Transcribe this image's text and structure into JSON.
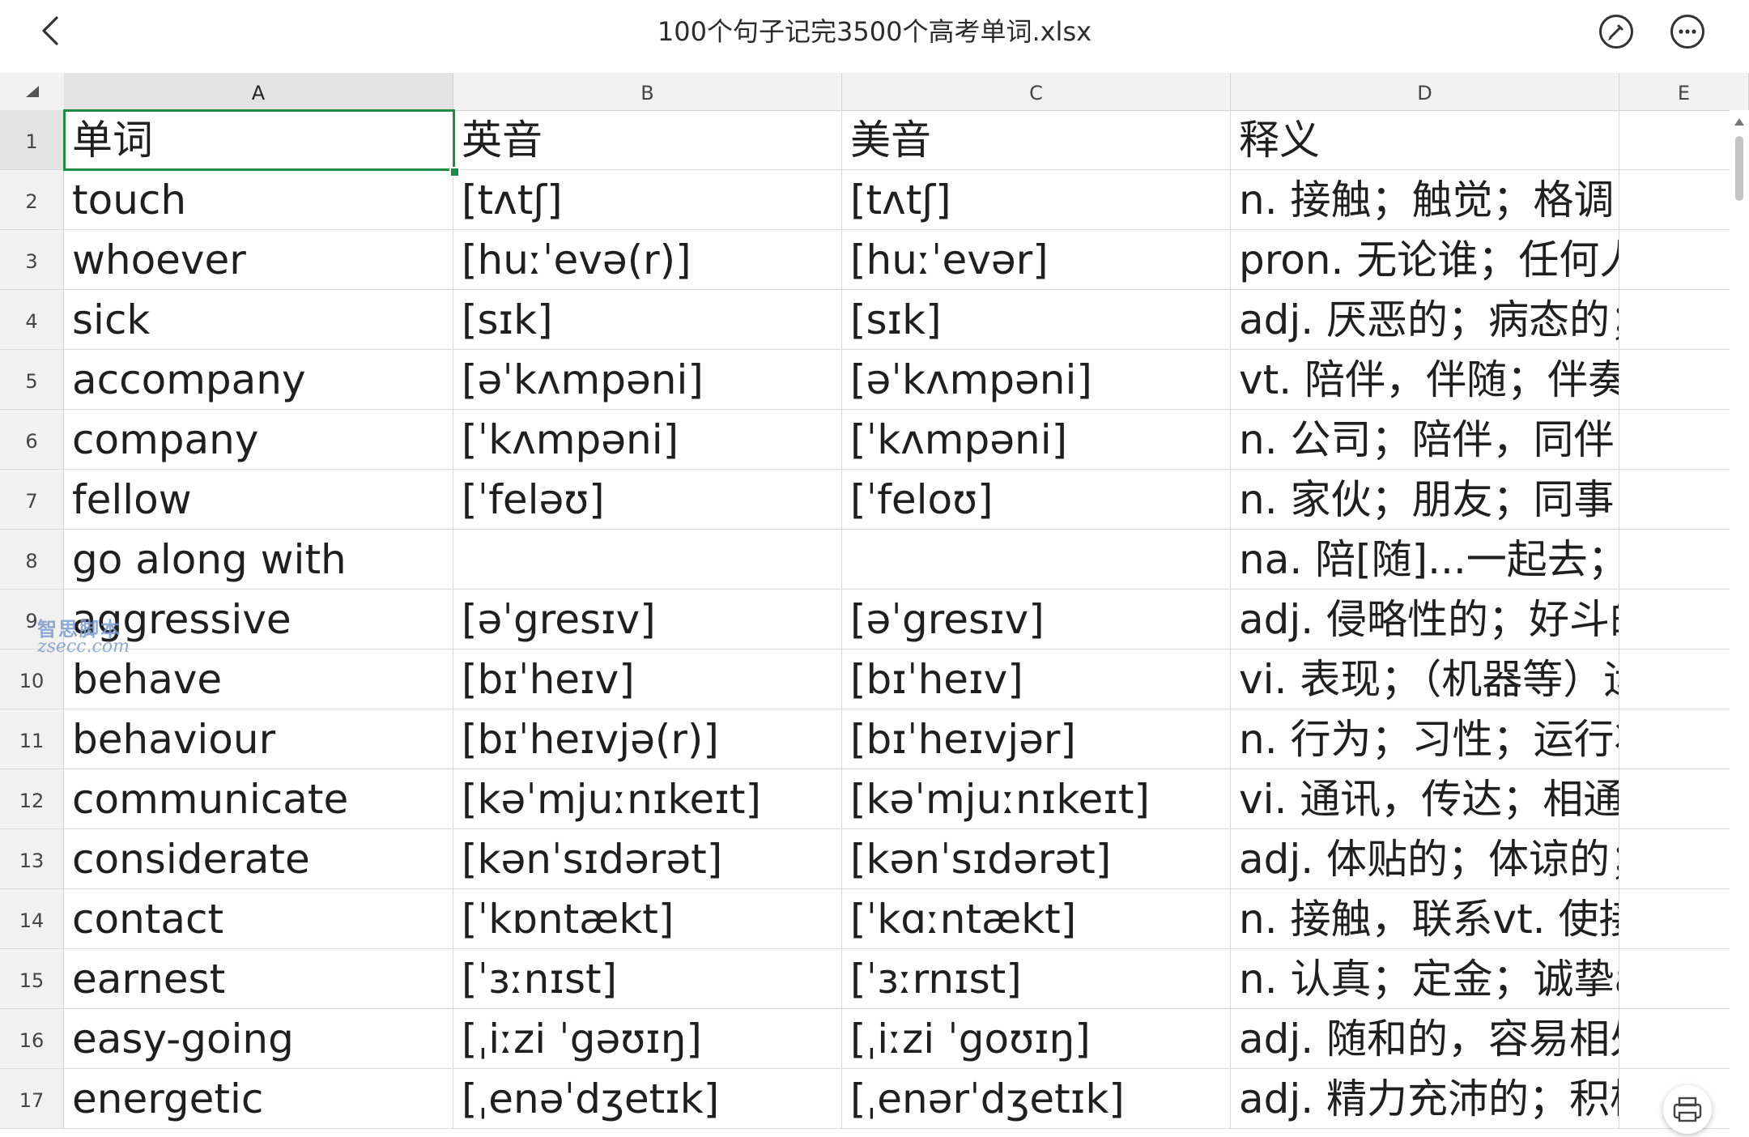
{
  "app": {
    "title": "100个句子记完3500个高考单词.xlsx"
  },
  "watermark": {
    "line1": "智思脚本",
    "line2": "zsecc.com"
  },
  "columns": [
    "A",
    "B",
    "C",
    "D",
    "E"
  ],
  "selected_cell": "A1",
  "rows": [
    {
      "n": "1",
      "a": "单词",
      "b": "英音",
      "c": "美音",
      "d": "释义"
    },
    {
      "n": "2",
      "a": "touch",
      "b": "[tʌtʃ]",
      "c": "[tʌtʃ]",
      "d": "n. 接触；触觉；格调；少"
    },
    {
      "n": "3",
      "a": "whoever",
      "b": "[huːˈevə(r)]",
      "c": "[huːˈevər]",
      "d": "pron. 无论谁；任何人n."
    },
    {
      "n": "4",
      "a": "sick",
      "b": "[sɪk]",
      "c": "[sɪk]",
      "d": "adj. 厌恶的；病态的；不"
    },
    {
      "n": "5",
      "a": "accompany",
      "b": "[əˈkʌmpəni]",
      "c": "[əˈkʌmpəni]",
      "d": "vt. 陪伴，伴随；伴奏vi. 伴"
    },
    {
      "n": "6",
      "a": "company",
      "b": "[ˈkʌmpəni]",
      "c": "[ˈkʌmpəni]",
      "d": "n. 公司；陪伴，同伴；连"
    },
    {
      "n": "7",
      "a": "fellow",
      "b": "[ˈfeləʊ]",
      "c": "[ˈfeloʊ]",
      "d": "n. 家伙；朋友；同事；会"
    },
    {
      "n": "8",
      "a": "go along with",
      "b": "",
      "c": "",
      "d": "na. 陪[随]...一起去；赞同"
    },
    {
      "n": "9",
      "a": "aggressive",
      "b": "[əˈgresɪv]",
      "c": "[əˈgresɪv]",
      "d": "adj. 侵略性的；好斗的；有"
    },
    {
      "n": "10",
      "a": "behave",
      "b": "[bɪˈheɪv]",
      "c": "[bɪˈheɪv]",
      "d": "vi. 表现；（机器等）运转"
    },
    {
      "n": "11",
      "a": "behaviour",
      "b": "[bɪˈheɪvjə(r)]",
      "c": "[bɪˈheɪvjər]",
      "d": "n. 行为；习性；运行状况"
    },
    {
      "n": "12",
      "a": "communicate",
      "b": "[kəˈmjuːnɪkeɪt]",
      "c": "[kəˈmjuːnɪkeɪt]",
      "d": "vi. 通讯，传达；相通；交"
    },
    {
      "n": "13",
      "a": "considerate",
      "b": "[kənˈsɪdərət]",
      "c": "[kənˈsɪdərət]",
      "d": "adj. 体贴的；体谅的；考虑"
    },
    {
      "n": "14",
      "a": "contact",
      "b": "[ˈkɒntækt]",
      "c": "[ˈkɑːntækt]",
      "d": "n. 接触，联系vt. 使接触，"
    },
    {
      "n": "15",
      "a": "earnest",
      "b": "[ˈɜːnɪst]",
      "c": "[ˈɜːrnɪst]",
      "d": "n. 认真；定金；诚挚adj."
    },
    {
      "n": "16",
      "a": "easy-going",
      "b": "[ˌiːzi ˈgəʊɪŋ]",
      "c": "[ˌiːzi ˈgoʊɪŋ]",
      "d": "adj. 随和的，容易相处的"
    },
    {
      "n": "17",
      "a": "energetic",
      "b": "[ˌenəˈdʒetɪk]",
      "c": "[ˌenərˈdʒetɪk]",
      "d": "adj. 精力充沛的；积极"
    }
  ]
}
